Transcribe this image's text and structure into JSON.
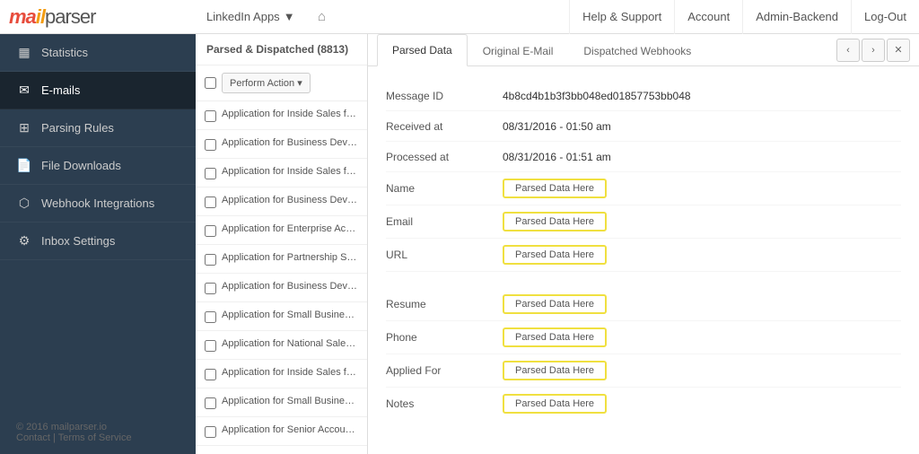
{
  "logo": {
    "mail": "ma",
    "icon": "il",
    "parser": "parser"
  },
  "top_nav": {
    "center": {
      "app_dropdown": "LinkedIn Apps",
      "home_icon": "⌂"
    },
    "right": [
      {
        "label": "Help & Support"
      },
      {
        "label": "Account"
      },
      {
        "label": "Admin-Backend"
      },
      {
        "label": "Log-Out"
      }
    ]
  },
  "sidebar": {
    "items": [
      {
        "id": "statistics",
        "icon": "📊",
        "label": "Statistics"
      },
      {
        "id": "emails",
        "icon": "✉",
        "label": "E-mails",
        "active": true
      },
      {
        "id": "parsing-rules",
        "icon": "🏗",
        "label": "Parsing Rules"
      },
      {
        "id": "file-downloads",
        "icon": "📄",
        "label": "File Downloads"
      },
      {
        "id": "webhook-integrations",
        "icon": "🔗",
        "label": "Webhook Integrations"
      },
      {
        "id": "inbox-settings",
        "icon": "⚙",
        "label": "Inbox Settings"
      }
    ],
    "footer": {
      "copyright": "© 2016 mailparser.io",
      "contact": "Contact",
      "separator": " | ",
      "terms": "Terms of Service"
    }
  },
  "email_list": {
    "header": "Parsed & Dispatched (8813)",
    "toolbar": {
      "action_btn": "Perform Action ▾"
    },
    "items": [
      "Application for Inside Sales fro…",
      "Application for Business Deve…",
      "Application for Inside Sales fro…",
      "Application for Business Deve…",
      "Application for Enterprise Acc…",
      "Application for Partnership Sa…",
      "Application for Business Deve…",
      "Application for Small Business…",
      "Application for National Sales …",
      "Application for Inside Sales fro…",
      "Application for Small Business…",
      "Application for Senior Account…"
    ]
  },
  "detail": {
    "tabs": [
      {
        "label": "Parsed Data",
        "active": true
      },
      {
        "label": "Original E-Mail",
        "active": false
      },
      {
        "label": "Dispatched Webhooks",
        "active": false
      }
    ],
    "nav_buttons": [
      "‹",
      "›",
      "✕"
    ],
    "fields": [
      {
        "label": "Message ID",
        "value": "4b8cd4b1b3f3bb048ed01857753bb048",
        "type": "text"
      },
      {
        "label": "Received at",
        "value": "08/31/2016 - 01:50 am",
        "type": "text"
      },
      {
        "label": "Processed at",
        "value": "08/31/2016 - 01:51 am",
        "type": "text"
      },
      {
        "label": "Name",
        "value": "Parsed Data Here",
        "type": "badge"
      },
      {
        "label": "Email",
        "value": "Parsed Data Here",
        "type": "badge"
      },
      {
        "label": "URL",
        "value": "Parsed Data Here",
        "type": "badge"
      },
      {
        "label": "",
        "value": "",
        "type": "spacer"
      },
      {
        "label": "Resume",
        "value": "Parsed Data Here",
        "type": "badge"
      },
      {
        "label": "Phone",
        "value": "Parsed Data Here",
        "type": "badge"
      },
      {
        "label": "Applied For",
        "value": "Parsed Data Here",
        "type": "badge"
      },
      {
        "label": "Notes",
        "value": "Parsed Data Here",
        "type": "badge"
      }
    ]
  }
}
